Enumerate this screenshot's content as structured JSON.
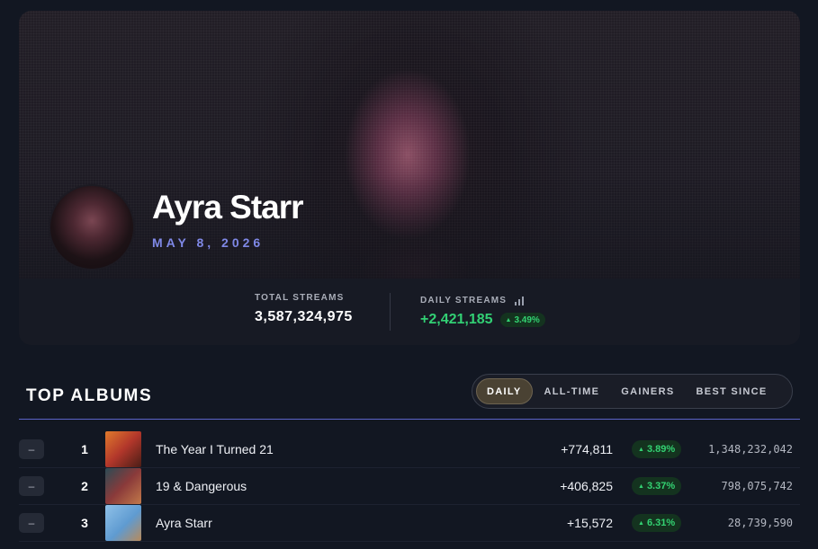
{
  "artist": {
    "name": "Ayra Starr",
    "date": "MAY 8, 2026"
  },
  "stats": {
    "total_label": "TOTAL STREAMS",
    "total_value": "3,587,324,975",
    "daily_label": "DAILY STREAMS",
    "daily_value": "+2,421,185",
    "daily_pct": "3.49%"
  },
  "albums_section": {
    "title": "TOP ALBUMS",
    "tabs": [
      "DAILY",
      "ALL-TIME",
      "GAINERS",
      "BEST SINCE"
    ],
    "active_tab": "DAILY"
  },
  "albums": [
    {
      "rank": "1",
      "title": "The Year I Turned 21",
      "delta": "+774,811",
      "pct": "3.89%",
      "total": "1,348,232,042",
      "button": "–"
    },
    {
      "rank": "2",
      "title": "19 & Dangerous",
      "delta": "+406,825",
      "pct": "3.37%",
      "total": "798,075,742",
      "button": "–"
    },
    {
      "rank": "3",
      "title": "Ayra Starr",
      "delta": "+15,572",
      "pct": "6.31%",
      "total": "28,739,590",
      "button": "–"
    }
  ],
  "icons": {
    "trend_up": "triangle-up-icon",
    "chart": "bar-chart-icon"
  },
  "colors": {
    "accent": "#7f88e6",
    "positive": "#32d074",
    "background": "#121722"
  }
}
